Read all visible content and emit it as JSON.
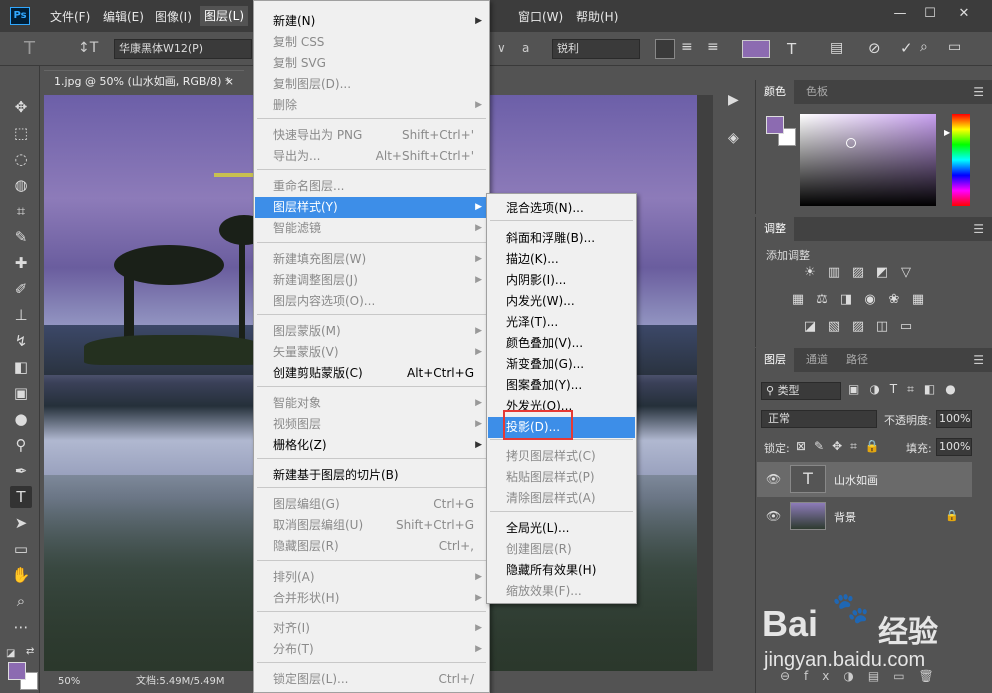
{
  "menubar": {
    "logo": "Ps",
    "items": [
      "文件(F)",
      "编辑(E)",
      "图像(I)",
      "图层(L)",
      "窗口(W)",
      "帮助(H)"
    ],
    "window_controls": [
      "—",
      "☐",
      "✕"
    ]
  },
  "options_bar": {
    "font": "华康黑体W12(P)",
    "aa_label": "a",
    "antialias": "锐利"
  },
  "doc_tab": {
    "title": "1.jpg @ 50% (山水如画, RGB/8) *",
    "close": "×"
  },
  "status_bar": {
    "zoom": "50%",
    "doc": "文档:5.49M/5.49M"
  },
  "layer_menu": {
    "items": [
      {
        "label": "新建(N)",
        "shortcut": "",
        "arrow": true,
        "disabled": false
      },
      {
        "label": "复制 CSS",
        "shortcut": "",
        "arrow": false,
        "disabled": true
      },
      {
        "label": "复制 SVG",
        "shortcut": "",
        "arrow": false,
        "disabled": true
      },
      {
        "label": "复制图层(D)...",
        "shortcut": "",
        "arrow": false,
        "disabled": true
      },
      {
        "label": "删除",
        "shortcut": "",
        "arrow": true,
        "disabled": true
      },
      {
        "label": "快速导出为 PNG",
        "shortcut": "Shift+Ctrl+'",
        "arrow": false,
        "disabled": true
      },
      {
        "label": "导出为...",
        "shortcut": "Alt+Shift+Ctrl+'",
        "arrow": false,
        "disabled": true
      },
      {
        "label": "重命名图层...",
        "shortcut": "",
        "arrow": false,
        "disabled": true
      },
      {
        "label": "图层样式(Y)",
        "shortcut": "",
        "arrow": true,
        "disabled": false,
        "highlighted": true
      },
      {
        "label": "智能滤镜",
        "shortcut": "",
        "arrow": true,
        "disabled": true
      },
      {
        "label": "新建填充图层(W)",
        "shortcut": "",
        "arrow": true,
        "disabled": true
      },
      {
        "label": "新建调整图层(J)",
        "shortcut": "",
        "arrow": true,
        "disabled": true
      },
      {
        "label": "图层内容选项(O)...",
        "shortcut": "",
        "arrow": false,
        "disabled": true
      },
      {
        "label": "图层蒙版(M)",
        "shortcut": "",
        "arrow": true,
        "disabled": true
      },
      {
        "label": "矢量蒙版(V)",
        "shortcut": "",
        "arrow": true,
        "disabled": true
      },
      {
        "label": "创建剪贴蒙版(C)",
        "shortcut": "Alt+Ctrl+G",
        "arrow": false,
        "disabled": false
      },
      {
        "label": "智能对象",
        "shortcut": "",
        "arrow": true,
        "disabled": true
      },
      {
        "label": "视频图层",
        "shortcut": "",
        "arrow": true,
        "disabled": true
      },
      {
        "label": "栅格化(Z)",
        "shortcut": "",
        "arrow": true,
        "disabled": false
      },
      {
        "label": "新建基于图层的切片(B)",
        "shortcut": "",
        "arrow": false,
        "disabled": false
      },
      {
        "label": "图层编组(G)",
        "shortcut": "Ctrl+G",
        "arrow": false,
        "disabled": true
      },
      {
        "label": "取消图层编组(U)",
        "shortcut": "Shift+Ctrl+G",
        "arrow": false,
        "disabled": true
      },
      {
        "label": "隐藏图层(R)",
        "shortcut": "Ctrl+,",
        "arrow": false,
        "disabled": true
      },
      {
        "label": "排列(A)",
        "shortcut": "",
        "arrow": true,
        "disabled": true
      },
      {
        "label": "合并形状(H)",
        "shortcut": "",
        "arrow": true,
        "disabled": true
      },
      {
        "label": "对齐(I)",
        "shortcut": "",
        "arrow": true,
        "disabled": true
      },
      {
        "label": "分布(T)",
        "shortcut": "",
        "arrow": true,
        "disabled": true
      },
      {
        "label": "锁定图层(L)...",
        "shortcut": "Ctrl+/",
        "arrow": false,
        "disabled": true
      }
    ]
  },
  "style_submenu": {
    "items": [
      {
        "label": "混合选项(N)...",
        "disabled": false
      },
      {
        "label": "斜面和浮雕(B)...",
        "disabled": false
      },
      {
        "label": "描边(K)...",
        "disabled": false
      },
      {
        "label": "内阴影(I)...",
        "disabled": false
      },
      {
        "label": "内发光(W)...",
        "disabled": false
      },
      {
        "label": "光泽(T)...",
        "disabled": false
      },
      {
        "label": "颜色叠加(V)...",
        "disabled": false
      },
      {
        "label": "渐变叠加(G)...",
        "disabled": false
      },
      {
        "label": "图案叠加(Y)...",
        "disabled": false
      },
      {
        "label": "外发光(O)...",
        "disabled": false
      },
      {
        "label": "投影(D)...",
        "disabled": false,
        "highlighted": true
      },
      {
        "label": "拷贝图层样式(C)",
        "disabled": true
      },
      {
        "label": "粘贴图层样式(P)",
        "disabled": true
      },
      {
        "label": "清除图层样式(A)",
        "disabled": true
      },
      {
        "label": "全局光(L)...",
        "disabled": false
      },
      {
        "label": "创建图层(R)",
        "disabled": true
      },
      {
        "label": "隐藏所有效果(H)",
        "disabled": false
      },
      {
        "label": "缩放效果(F)...",
        "disabled": true
      }
    ]
  },
  "color_panel": {
    "tabs": [
      "颜色",
      "色板"
    ],
    "foreground": "#8c6bb1",
    "background": "#ffffff"
  },
  "adjust_panel": {
    "tab": "调整",
    "title": "添加调整"
  },
  "layers_panel": {
    "tabs": [
      "图层",
      "通道",
      "路径"
    ],
    "filter": "类型",
    "blend_mode": "正常",
    "opacity_label": "不透明度:",
    "opacity": "100%",
    "lock_label": "锁定:",
    "fill_label": "填充:",
    "fill": "100%",
    "layers": [
      {
        "name": "山水如画",
        "type": "text",
        "selected": true
      },
      {
        "name": "背景",
        "type": "image",
        "locked": true
      }
    ]
  },
  "watermark": {
    "brand": "Bai",
    "brand2": "经验",
    "url": "jingyan.baidu.com"
  },
  "colors": {
    "accent": "#3d8ee8",
    "highlight_box": "#e53935"
  }
}
